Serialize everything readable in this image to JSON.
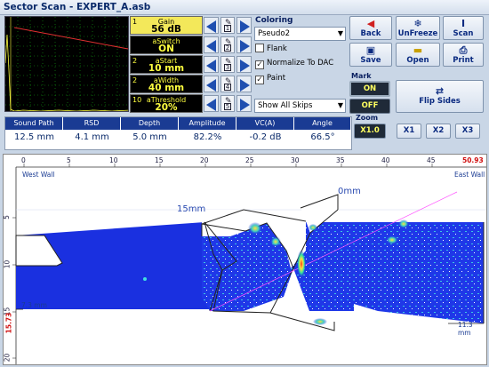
{
  "window": {
    "title": "Sector Scan - EXPERT_A.asb"
  },
  "params": [
    {
      "index": "1",
      "name": "Gain",
      "value": "56 dB",
      "selected": true
    },
    {
      "index": "",
      "name": "aSwitch",
      "value": "ON",
      "selected": false
    },
    {
      "index": "2",
      "name": "aStart",
      "value": "10 mm",
      "selected": false
    },
    {
      "index": "2",
      "name": "aWidth",
      "value": "40 mm",
      "selected": false
    },
    {
      "index": "10",
      "name": "aThreshold",
      "value": "20%",
      "selected": false
    }
  ],
  "controls": [
    {
      "key": "1"
    },
    {
      "key": "2"
    },
    {
      "key": "3"
    },
    {
      "key": "4"
    },
    {
      "key": "5"
    }
  ],
  "coloring": {
    "label": "Coloring",
    "palette": "Pseudo2",
    "flank": "Flank",
    "normalize": "Normalize To DAC",
    "paint": "Paint",
    "skips": "Show All Skips"
  },
  "buttons": {
    "back": "Back",
    "unfreeze": "UnFreeze",
    "scan": "Scan",
    "save": "Save",
    "open": "Open",
    "print": "Print",
    "flip": "Flip Sides"
  },
  "mark": {
    "label": "Mark",
    "on": "ON",
    "off": "OFF"
  },
  "zoom": {
    "label": "Zoom",
    "levels": [
      "X1.0",
      "X1",
      "X2",
      "X3"
    ],
    "selected": "X1.0"
  },
  "readings": {
    "headers": [
      "Sound Path",
      "RSD",
      "Depth",
      "Amplitude",
      "VC(A)",
      "Angle"
    ],
    "values": [
      "12.5 mm",
      "4.1 mm",
      "5.0 mm",
      "82.2%",
      "-0.2 dB",
      "66.5°"
    ]
  },
  "scan": {
    "ruler_ticks": [
      "0",
      "5",
      "10",
      "15",
      "20",
      "25",
      "30",
      "35",
      "40",
      "45"
    ],
    "ruler_end": "50.93",
    "depth_ticks": [
      "5",
      "10",
      "15",
      "20"
    ],
    "depth_marker": "15.73",
    "west": "West Wall",
    "east": "East Wall",
    "label_0mm": "0mm",
    "label_15mm": "15mm",
    "left_thk": "7.3 mm",
    "right_thk": "11.3 mm"
  },
  "colors": {
    "accent": "#1a3b93",
    "scan_blue": "#1a30e0",
    "selected_param": "#f3e85a"
  }
}
